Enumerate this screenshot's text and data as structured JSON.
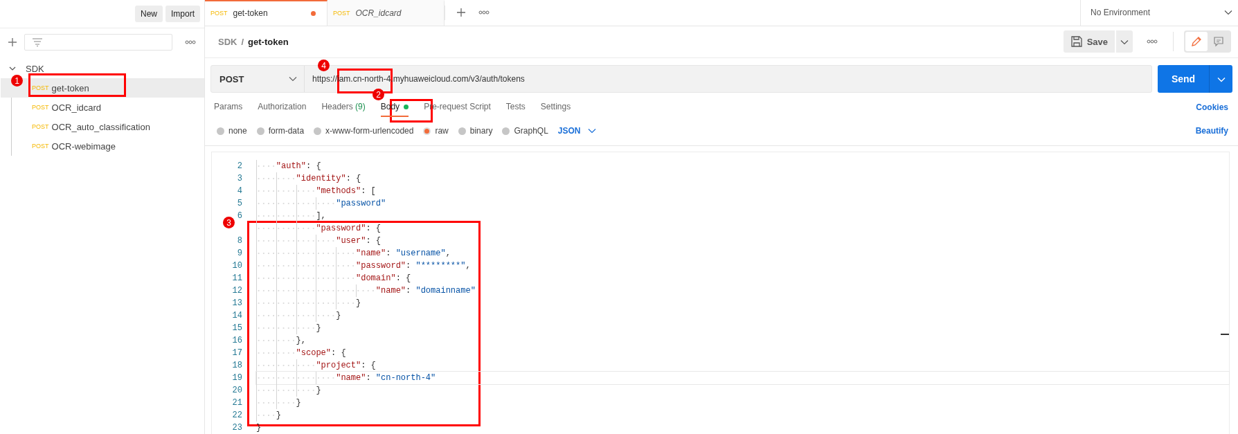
{
  "sidebar": {
    "buttons": [
      "New",
      "Import"
    ],
    "collections": [
      {
        "name": "SDK",
        "expanded": true,
        "children": [
          {
            "method": "POST",
            "name": "get-token",
            "selected": true
          },
          {
            "method": "POST",
            "name": "OCR_idcard",
            "selected": false
          },
          {
            "method": "POST",
            "name": "OCR_auto_classification",
            "selected": false
          },
          {
            "method": "POST",
            "name": "OCR-webimage",
            "selected": false
          }
        ]
      }
    ]
  },
  "tabs": [
    {
      "method": "POST",
      "name": "get-token",
      "selected": true,
      "unsaved": true,
      "italic": false
    },
    {
      "method": "POST",
      "name": "OCR_idcard",
      "selected": false,
      "unsaved": false,
      "italic": true
    }
  ],
  "environment": "No Environment",
  "breadcrumb": [
    "SDK",
    "/",
    "get-token"
  ],
  "save_button": "Save",
  "view_modes": [
    {
      "kind": "edit",
      "selected": true
    },
    {
      "kind": "comments",
      "selected": false
    }
  ],
  "request": {
    "method": "POST",
    "url": "https://iam.cn-north-4.myhuaweicloud.com/v3/auth/tokens",
    "send": "Send"
  },
  "request_tabs": [
    {
      "label": "Params",
      "selected": false
    },
    {
      "label": "Authorization",
      "selected": false
    },
    {
      "label": "Headers",
      "count": "(9)",
      "selected": false
    },
    {
      "label": "Body",
      "selected": true,
      "dot": true
    },
    {
      "label": "Pre-request Script",
      "selected": false
    },
    {
      "label": "Tests",
      "selected": false
    },
    {
      "label": "Settings",
      "selected": false
    }
  ],
  "cookies": "Cookies",
  "body_types": [
    {
      "label": "none",
      "selected": false
    },
    {
      "label": "form-data",
      "selected": false
    },
    {
      "label": "x-www-form-urlencoded",
      "selected": false
    },
    {
      "label": "raw",
      "selected": true
    },
    {
      "label": "binary",
      "selected": false
    },
    {
      "label": "GraphQL",
      "selected": false
    }
  ],
  "format": "JSON",
  "beautify": "Beautify",
  "code_lines": [
    {
      "number": "2",
      "text": "    \"auth\": {"
    },
    {
      "number": "3",
      "text": "        \"identity\": {"
    },
    {
      "number": "4",
      "text": "            \"methods\": ["
    },
    {
      "number": "5",
      "text": "                \"password\""
    },
    {
      "number": "6",
      "text": "            ],"
    },
    {
      "text": "            \"password\": {"
    },
    {
      "number": "8",
      "text": "                \"user\": {"
    },
    {
      "number": "9",
      "text": "                    \"name\": \"username\","
    },
    {
      "number": "10",
      "text": "                    \"password\": \"********\","
    },
    {
      "number": "11",
      "text": "                    \"domain\": {"
    },
    {
      "number": "12",
      "text": "                        \"name\": \"domainname\""
    },
    {
      "number": "13",
      "text": "                    }"
    },
    {
      "number": "14",
      "text": "                }"
    },
    {
      "number": "15",
      "text": "            }"
    },
    {
      "number": "16",
      "text": "        },"
    },
    {
      "number": "17",
      "text": "        \"scope\": {"
    },
    {
      "number": "18",
      "text": "            \"project\": {"
    },
    {
      "number": "19",
      "text": "                \"name\": \"cn-north-4\""
    },
    {
      "number": "20",
      "text": "            }"
    },
    {
      "number": "21",
      "text": "        }"
    },
    {
      "number": "22",
      "text": "    }"
    },
    {
      "number": "23",
      "text": "}"
    }
  ],
  "annotations": [
    {
      "label": "1"
    },
    {
      "label": "2"
    },
    {
      "label": "3"
    },
    {
      "label": "4"
    }
  ]
}
